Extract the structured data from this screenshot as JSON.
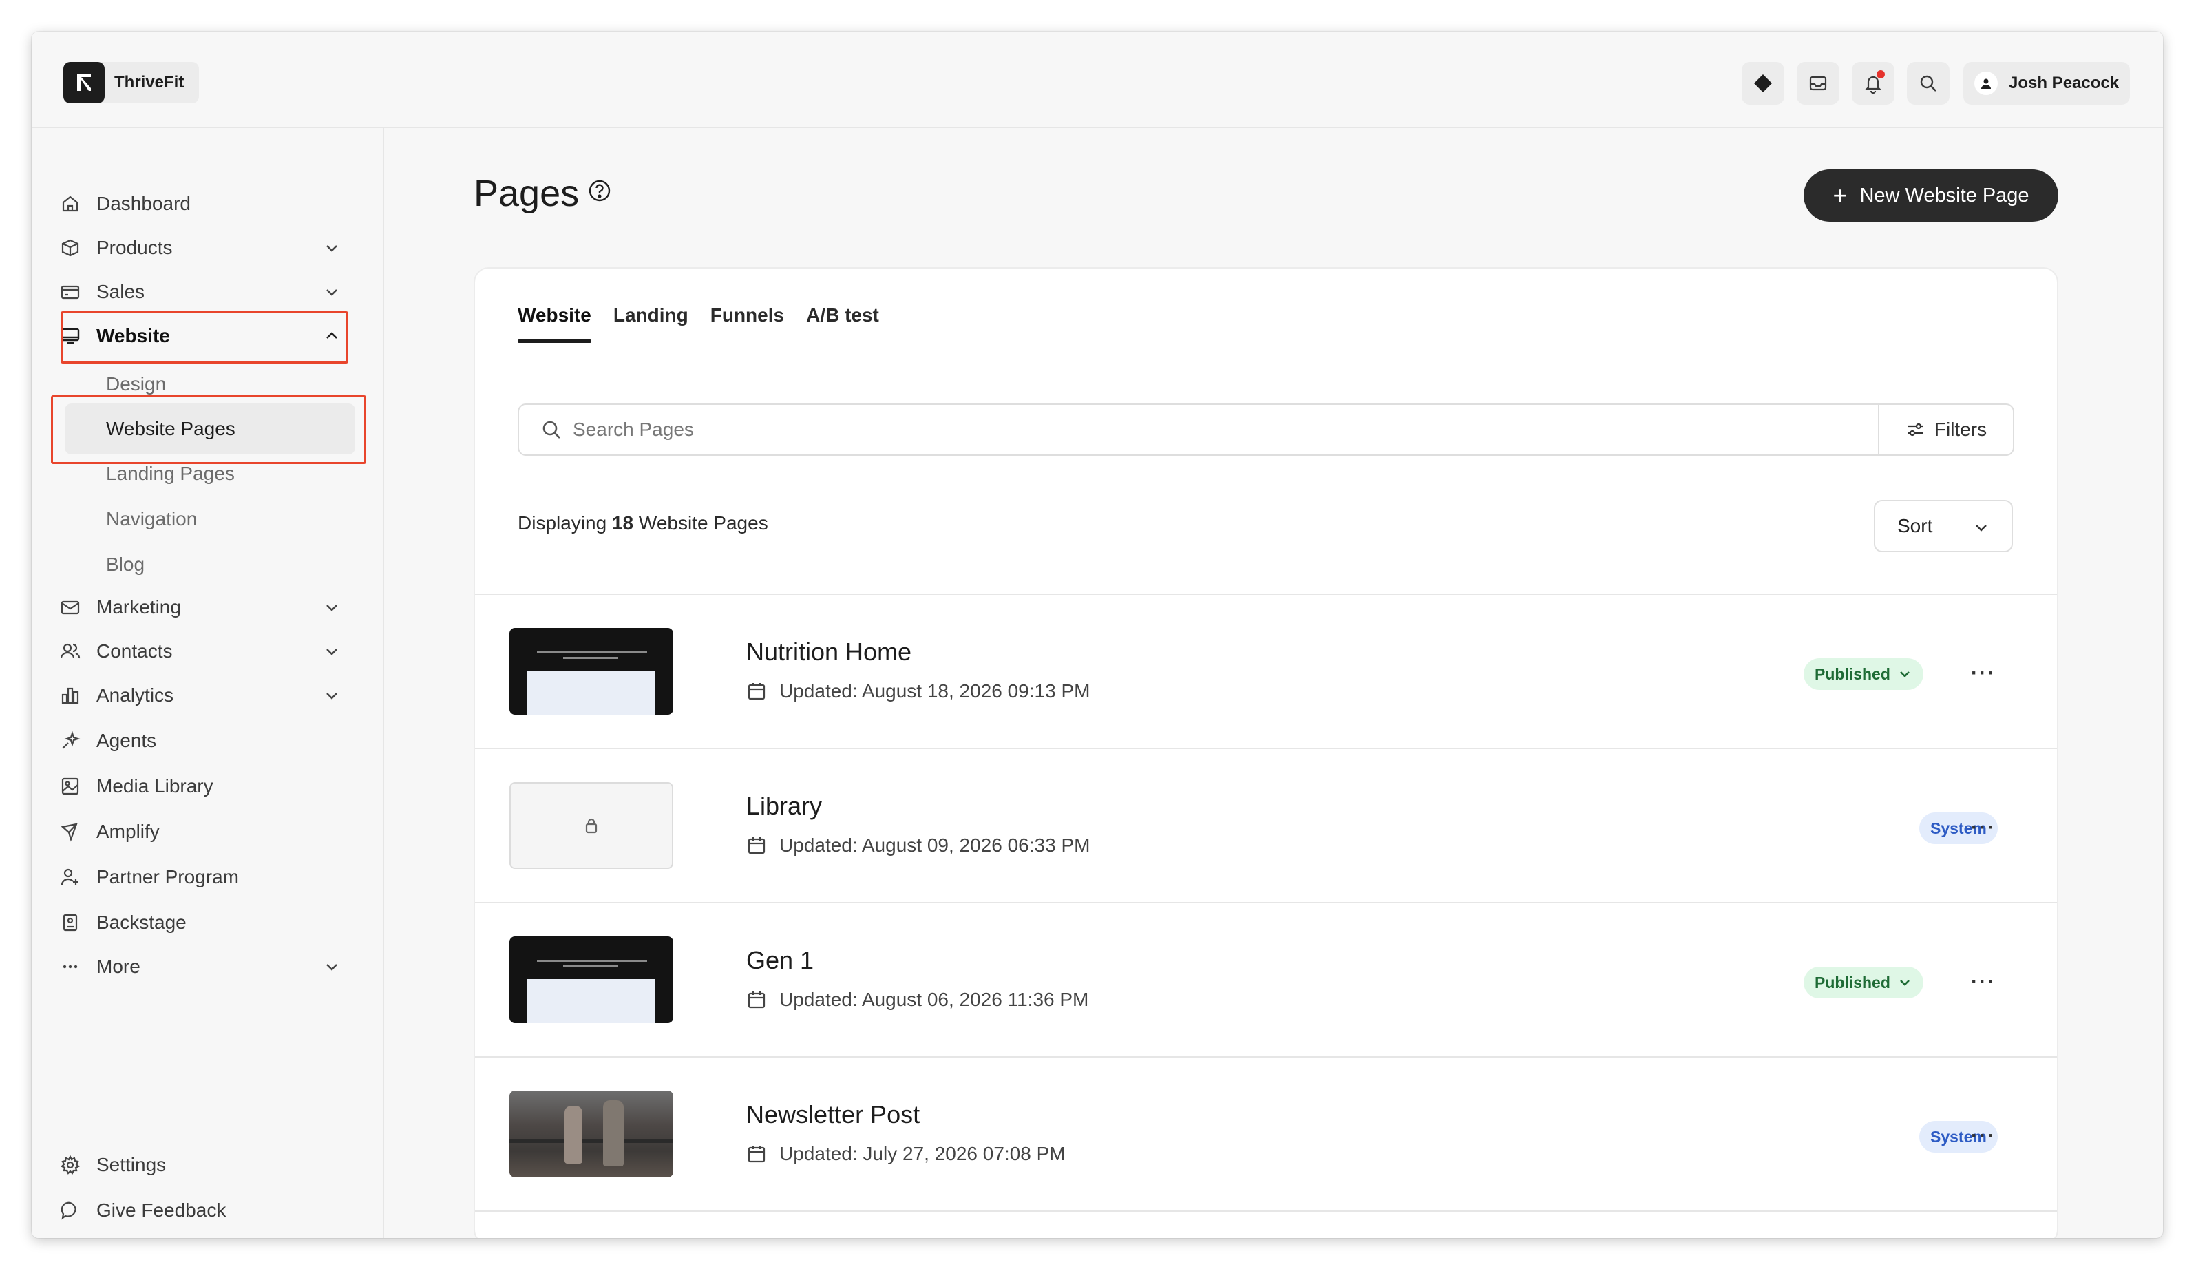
{
  "app": {
    "brand_name": "ThriveFit",
    "user_name": "Josh Peacock"
  },
  "sidebar": {
    "items": [
      {
        "label": "Dashboard"
      },
      {
        "label": "Products"
      },
      {
        "label": "Sales"
      },
      {
        "label": "Website"
      },
      {
        "label": "Marketing"
      },
      {
        "label": "Contacts"
      },
      {
        "label": "Analytics"
      },
      {
        "label": "Agents"
      },
      {
        "label": "Media Library"
      },
      {
        "label": "Amplify"
      },
      {
        "label": "Partner Program"
      },
      {
        "label": "Backstage"
      },
      {
        "label": "More"
      }
    ],
    "website_sub": [
      "Design",
      "Website Pages",
      "Landing Pages",
      "Navigation",
      "Blog"
    ],
    "bottom": [
      {
        "label": "Settings"
      },
      {
        "label": "Give Feedback"
      }
    ]
  },
  "main": {
    "title": "Pages",
    "new_button": "New Website Page",
    "tabs": [
      "Website",
      "Landing",
      "Funnels",
      "A/B test"
    ],
    "search_placeholder": "Search Pages",
    "filters_label": "Filters",
    "count_prefix": "Displaying",
    "count_value": "18",
    "count_suffix": "Website Pages",
    "sort_label": "Sort",
    "pages": [
      {
        "title": "Nutrition Home",
        "updated": "Updated: August 18, 2026 09:13 PM",
        "status": "Published"
      },
      {
        "title": "Library",
        "updated": "Updated: August 09, 2026 06:33 PM",
        "status": "System"
      },
      {
        "title": "Gen 1",
        "updated": "Updated: August 06, 2026 11:36 PM",
        "status": "Published"
      },
      {
        "title": "Newsletter Post",
        "updated": "Updated: July 27, 2026 07:08 PM",
        "status": "System"
      }
    ]
  },
  "colors": {
    "highlight": "#e8452c",
    "published_bg": "#dff7e6",
    "published_text": "#1e6b35",
    "system_bg": "#e3ecfc",
    "system_text": "#2d5bc4",
    "notification_dot": "#e5322c"
  }
}
